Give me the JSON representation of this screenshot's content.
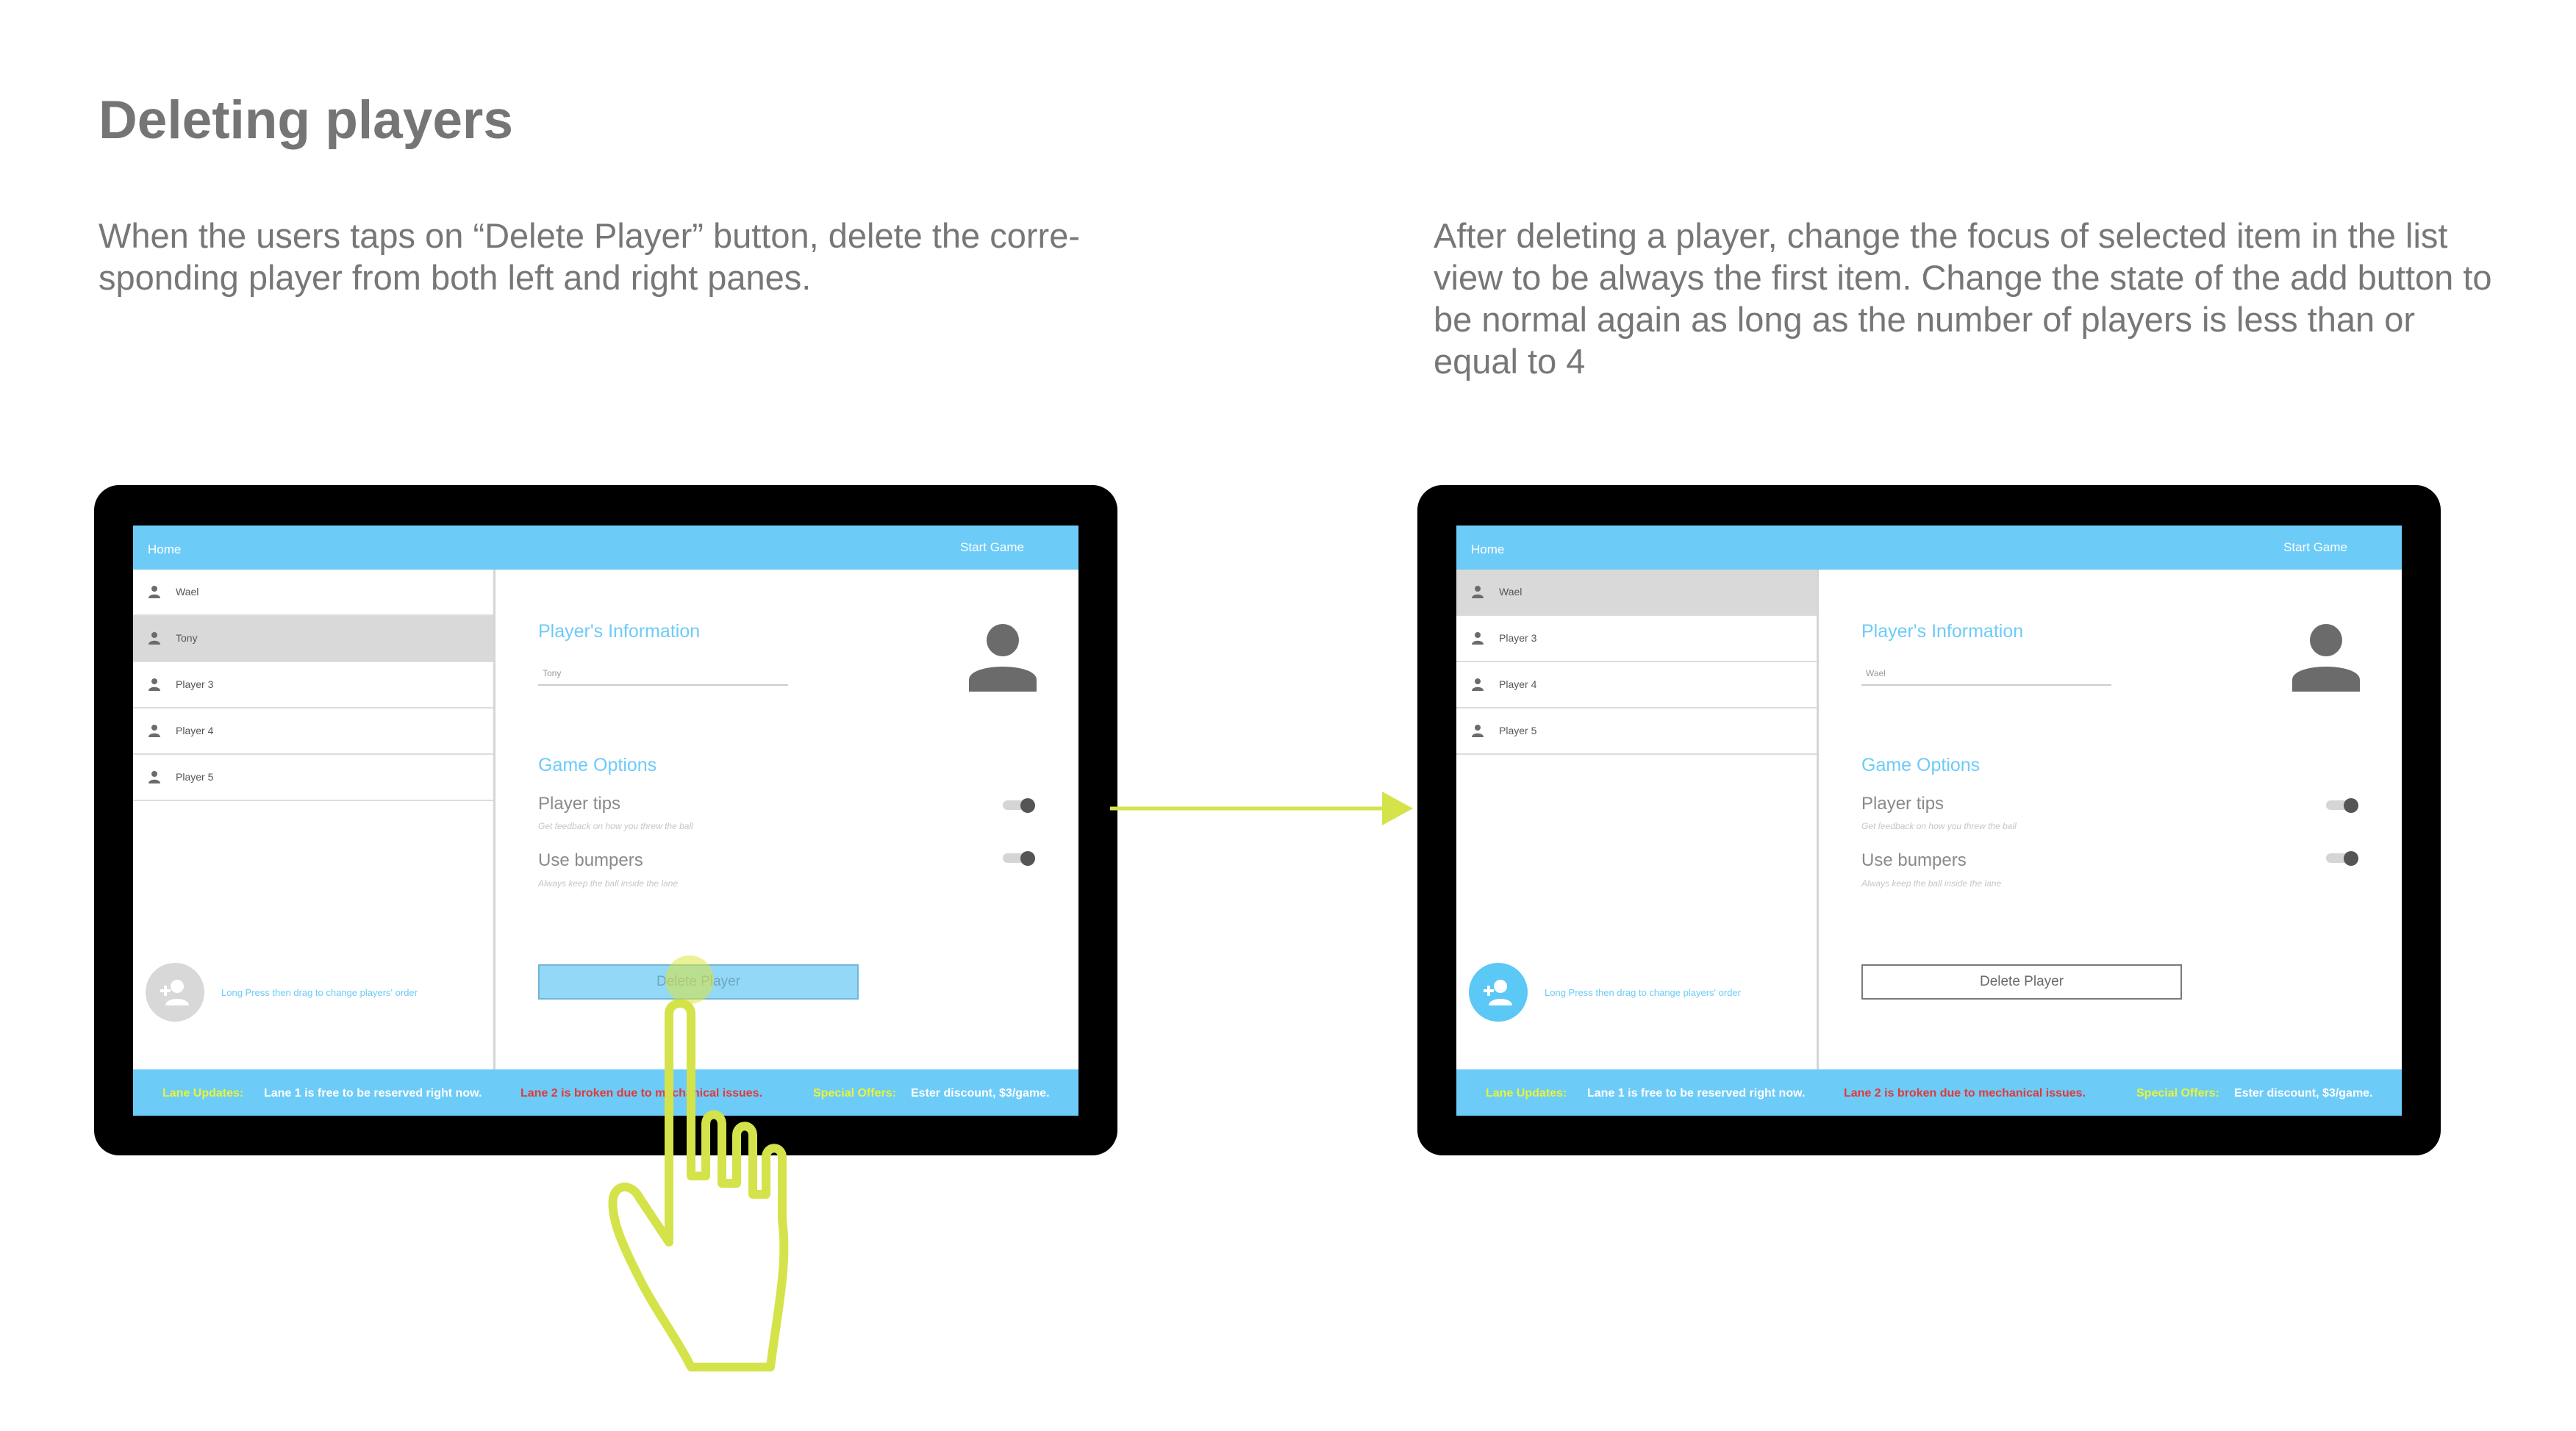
{
  "page": {
    "title": "Deleting players",
    "description_left": "When the users taps on “Delete Player” button, delete the corre-sponding player from both left and right panes.",
    "description_right": "After deleting a player, change the focus of selected item in the list view to be always the first item. Change the state of the add button to be normal again as long as the number of players is less than or equal to 4"
  },
  "before": {
    "appbar": {
      "home": "Home",
      "start": "Start Game"
    },
    "players": [
      {
        "label": "Wael"
      },
      {
        "label": "Tony"
      },
      {
        "label": "Player 3"
      },
      {
        "label": "Player 4"
      },
      {
        "label": "Player 5"
      }
    ],
    "selected_player": "Tony",
    "hint": "Long Press then drag to change players' order",
    "info_header": "Player's Information",
    "name_value": "Tony",
    "options_header": "Game Options",
    "tips_label": "Player tips",
    "tips_sub": "Get feedback on how you threw the ball",
    "bumpers_label": "Use bumpers",
    "bumpers_sub": "Always keep the ball inside the lane",
    "delete_label": "Delete Player",
    "ticker": {
      "lane_updates_label": "Lane Updates:",
      "lane1": "Lane 1 is free to be reserved right now.",
      "lane2": "Lane 2 is broken due to mechanical issues.",
      "offers_label": "Special Offers:",
      "offer": "Ester discount, $3/game."
    }
  },
  "after": {
    "appbar": {
      "home": "Home",
      "start": "Start Game"
    },
    "players": [
      {
        "label": "Wael"
      },
      {
        "label": "Player 3"
      },
      {
        "label": "Player 4"
      },
      {
        "label": "Player 5"
      }
    ],
    "selected_player": "Wael",
    "hint": "Long Press then drag to change players' order",
    "info_header": "Player's Information",
    "name_value": "Wael",
    "options_header": "Game Options",
    "tips_label": "Player tips",
    "tips_sub": "Get feedback on how you threw the ball",
    "bumpers_label": "Use bumpers",
    "bumpers_sub": "Always keep the ball inside the lane",
    "delete_label": "Delete Player",
    "ticker": {
      "lane_updates_label": "Lane Updates:",
      "lane1": "Lane 1 is free to be reserved right now.",
      "lane2": "Lane 2 is broken due to mechanical issues.",
      "offers_label": "Special Offers:",
      "offer": "Ester discount, $3/game."
    }
  },
  "colors": {
    "accent": "#6dcbf7",
    "ticker_label": "#e8f53a",
    "ticker_alert": "#e03a3a",
    "annotation": "#d4e34a"
  },
  "icons": {
    "row": "person-icon",
    "avatar": "avatar-icon",
    "add": "add-person-icon",
    "arrow": "arrow-right-icon",
    "hand": "tap-hand-icon"
  }
}
